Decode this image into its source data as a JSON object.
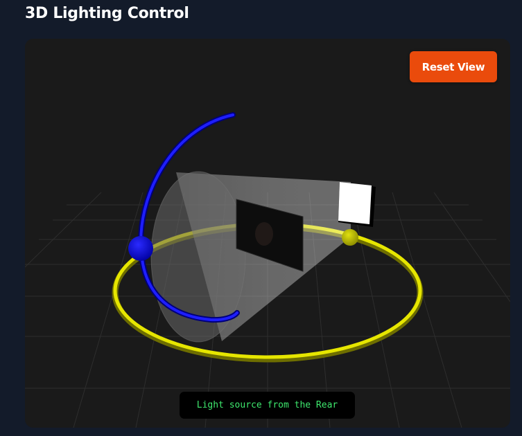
{
  "header": {
    "title": "3D Lighting Control"
  },
  "toolbar": {
    "reset_label": "Reset View"
  },
  "status": {
    "text": "Light source from the Rear"
  },
  "colors": {
    "background": "#131b2a",
    "viewport": "#1a1a1a",
    "accent_button": "#ea4b0c",
    "status_text": "#3ee96e",
    "azimuth_ring": "#e6e600",
    "elevation_arc": "#1a1aff",
    "grid": "#2e2e2e"
  }
}
